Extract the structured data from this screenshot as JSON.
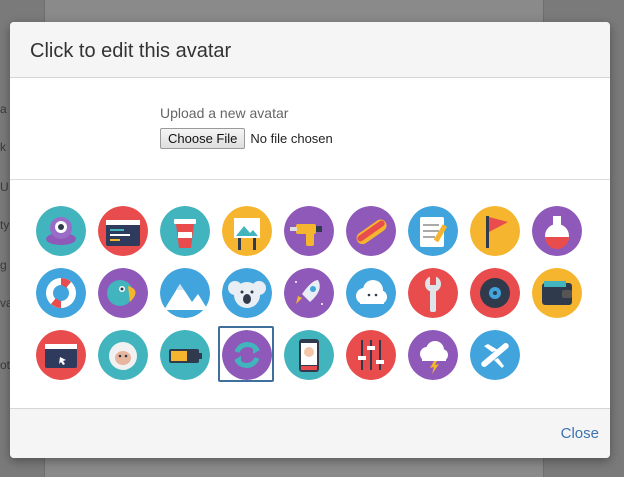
{
  "background": {
    "letters": [
      "a",
      "k",
      "U",
      "ty",
      "g",
      "va",
      "ot"
    ]
  },
  "modal": {
    "title": "Click to edit this avatar",
    "upload_label": "Upload a new avatar",
    "choose_file_label": "Choose File",
    "file_status": "No file chosen",
    "close_label": "Close",
    "selected_avatar": "sync-avatar"
  },
  "avatars": [
    {
      "name": "alien-robot-avatar",
      "bg": "#41b4bd"
    },
    {
      "name": "code-window-avatar",
      "bg": "#e84c4c"
    },
    {
      "name": "coffee-cup-avatar",
      "bg": "#41b4bd"
    },
    {
      "name": "easel-picture-avatar",
      "bg": "#f6b52e"
    },
    {
      "name": "drill-avatar",
      "bg": "#8e59b8"
    },
    {
      "name": "hotdog-avatar",
      "bg": "#8e59b8"
    },
    {
      "name": "notepad-pencil-avatar",
      "bg": "#41a4dc"
    },
    {
      "name": "flag-avatar",
      "bg": "#f6b52e"
    },
    {
      "name": "potion-flask-avatar",
      "bg": "#8e59b8"
    },
    {
      "name": "lifebuoy-avatar",
      "bg": "#41a4dc"
    },
    {
      "name": "parrot-avatar",
      "bg": "#8e59b8"
    },
    {
      "name": "mountains-avatar",
      "bg": "#41a4dc"
    },
    {
      "name": "koala-avatar",
      "bg": "#41a4dc"
    },
    {
      "name": "rocket-avatar",
      "bg": "#8e59b8"
    },
    {
      "name": "cloud-face-avatar",
      "bg": "#41a4dc"
    },
    {
      "name": "wrench-avatar",
      "bg": "#e84c4c"
    },
    {
      "name": "vinyl-record-avatar",
      "bg": "#e84c4c"
    },
    {
      "name": "wallet-avatar",
      "bg": "#f6b52e"
    },
    {
      "name": "browser-cursor-avatar",
      "bg": "#e84c4c"
    },
    {
      "name": "yeti-avatar",
      "bg": "#41b4bd"
    },
    {
      "name": "battery-avatar",
      "bg": "#41b4bd"
    },
    {
      "name": "sync-avatar",
      "bg": "#8e59b8"
    },
    {
      "name": "phone-face-avatar",
      "bg": "#41b4bd"
    },
    {
      "name": "mixer-sliders-avatar",
      "bg": "#e84c4c"
    },
    {
      "name": "storm-cloud-avatar",
      "bg": "#8e59b8"
    },
    {
      "name": "airplane-avatar",
      "bg": "#41a4dc"
    }
  ]
}
